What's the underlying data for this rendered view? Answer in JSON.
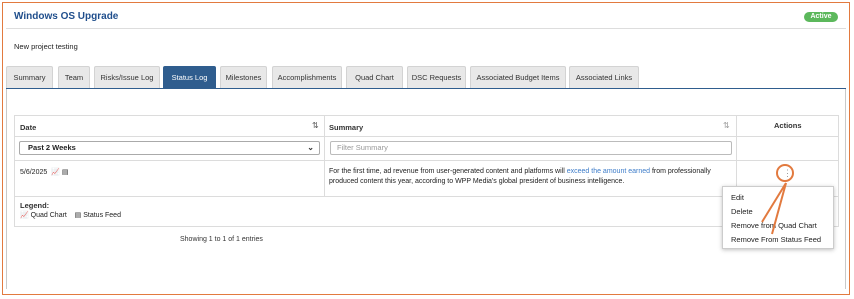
{
  "project": {
    "title": "Windows OS Upgrade",
    "status": "Active",
    "description": "New project testing"
  },
  "tabs": [
    {
      "label": "Summary"
    },
    {
      "label": "Team"
    },
    {
      "label": "Risks/Issue Log"
    },
    {
      "label": "Status Log"
    },
    {
      "label": "Milestones"
    },
    {
      "label": "Accomplishments"
    },
    {
      "label": "Quad Chart"
    },
    {
      "label": "DSC Requests"
    },
    {
      "label": "Associated Budget Items"
    },
    {
      "label": "Associated Links"
    }
  ],
  "active_tab": "Status Log",
  "table": {
    "columns": {
      "date": "Date",
      "summary": "Summary",
      "actions": "Actions"
    },
    "filters": {
      "date_value": "Past 2 Weeks",
      "summary_placeholder": "Filter Summary"
    },
    "rows": [
      {
        "date": "5/6/2025",
        "summary_pre": "For the first time, ad revenue from user-generated content and platforms will ",
        "summary_link": "exceed the amount earned",
        "summary_post": " from professionally produced content this year, according to WPP Media's global president of business intelligence."
      }
    ]
  },
  "legend": {
    "title": "Legend:",
    "quad_chart": "Quad Chart",
    "status_feed": "Status Feed"
  },
  "entries_info": "Showing 1 to 1 of 1 entries",
  "action_menu": [
    "Edit",
    "Delete",
    "Remove from Quad Chart",
    "Remove From Status Feed"
  ],
  "colors": {
    "accent": "#2f5d8e",
    "active_badge": "#5cb85c",
    "annotation": "#e27a3f",
    "link": "#3d7cc9"
  },
  "icons": [
    "chart-icon",
    "feed-icon",
    "kebab-icon",
    "sort-icon",
    "chevron-down-icon"
  ]
}
